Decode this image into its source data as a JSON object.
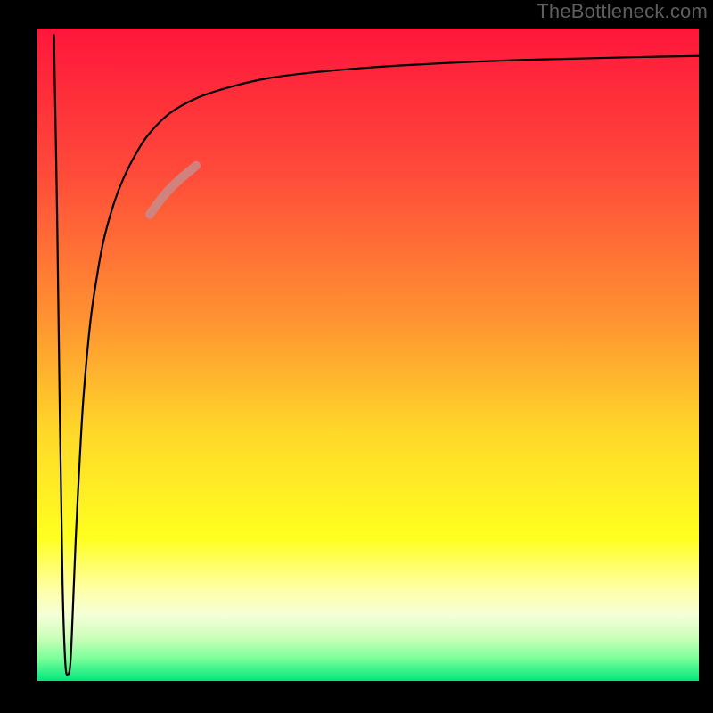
{
  "watermark": "TheBottleneck.com",
  "chart_data": {
    "type": "line",
    "title": "",
    "xlabel": "",
    "ylabel": "",
    "xlim": [
      0,
      100
    ],
    "ylim": [
      0,
      100
    ],
    "axes_visible": false,
    "grid": false,
    "background_gradient": {
      "stops": [
        {
          "pos": 0.0,
          "color": "#ff163b"
        },
        {
          "pos": 0.22,
          "color": "#ff4a3a"
        },
        {
          "pos": 0.45,
          "color": "#ff9431"
        },
        {
          "pos": 0.62,
          "color": "#ffd829"
        },
        {
          "pos": 0.78,
          "color": "#ffff1f"
        },
        {
          "pos": 0.86,
          "color": "#ffffa8"
        },
        {
          "pos": 0.9,
          "color": "#f4ffd8"
        },
        {
          "pos": 0.935,
          "color": "#c9ffb8"
        },
        {
          "pos": 0.965,
          "color": "#7dff9a"
        },
        {
          "pos": 1.0,
          "color": "#00e77c"
        }
      ]
    },
    "series": [
      {
        "name": "bottleneck-curve",
        "color": "#000000",
        "width": 2.2,
        "x": [
          2.5,
          3.0,
          3.4,
          3.8,
          4.2,
          4.6,
          5.0,
          5.4,
          5.8,
          6.4,
          7.0,
          8.0,
          9.0,
          10.0,
          11.5,
          13.0,
          15.0,
          17.0,
          20.0,
          24.0,
          29.0,
          35.0,
          42.0,
          50.0,
          58.0,
          66.0,
          74.0,
          82.0,
          90.0,
          100.0
        ],
        "y": [
          99.0,
          70.0,
          40.0,
          15.0,
          3.0,
          1.0,
          3.0,
          12.0,
          22.0,
          34.0,
          44.0,
          55.0,
          62.0,
          67.5,
          73.0,
          77.0,
          81.0,
          84.0,
          87.0,
          89.3,
          91.0,
          92.4,
          93.3,
          94.0,
          94.5,
          94.9,
          95.2,
          95.4,
          95.6,
          95.8
        ]
      },
      {
        "name": "highlight-segment",
        "color": "#c98b8b",
        "opacity": 0.85,
        "width": 10,
        "x": [
          17.0,
          18.5,
          20.0,
          22.0,
          24.0
        ],
        "y": [
          71.5,
          73.6,
          75.4,
          77.3,
          79.0
        ]
      }
    ],
    "frame": {
      "color": "#000000",
      "left_width": 42,
      "right_width": 16,
      "top_width": 32,
      "bottom_width": 36
    }
  }
}
